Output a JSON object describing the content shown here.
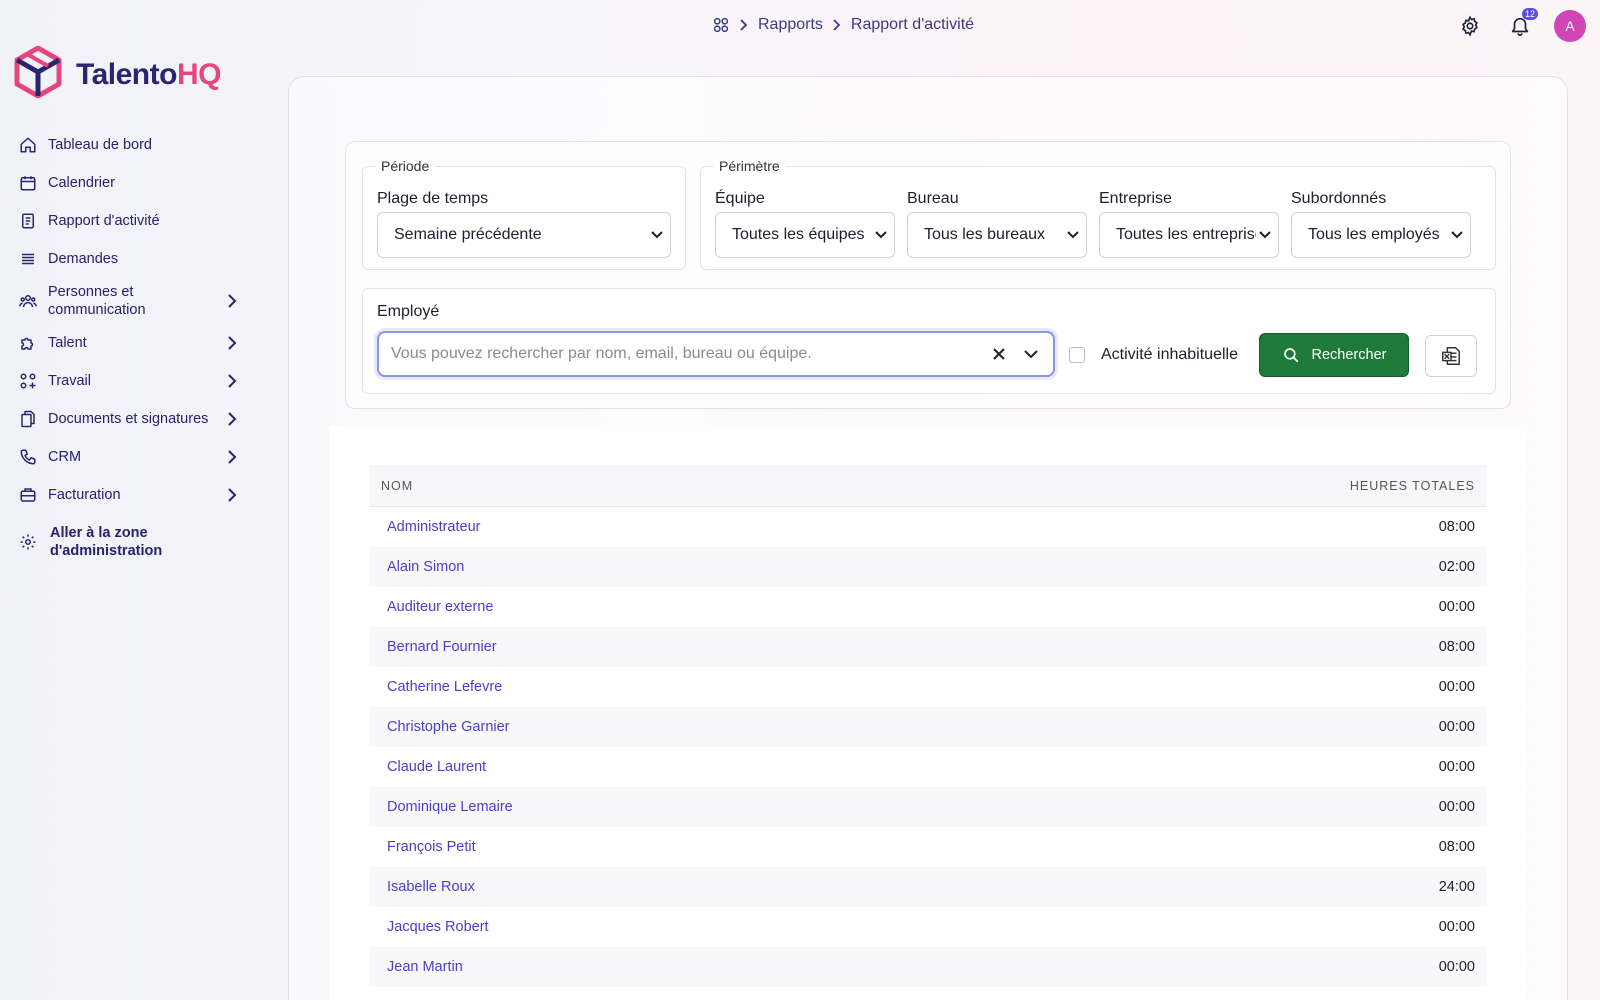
{
  "brand": {
    "part1": "Talento",
    "part2": "HQ"
  },
  "sidebar": {
    "items": [
      {
        "label": "Tableau de bord",
        "icon": "home-icon"
      },
      {
        "label": "Calendrier",
        "icon": "calendar-icon"
      },
      {
        "label": "Rapport d'activité",
        "icon": "report-icon"
      },
      {
        "label": "Demandes",
        "icon": "list-icon"
      },
      {
        "label": "Personnes et communication",
        "icon": "people-icon"
      },
      {
        "label": "Talent",
        "icon": "puzzle-icon"
      },
      {
        "label": "Travail",
        "icon": "grid-icon"
      },
      {
        "label": "Documents et signatures",
        "icon": "documents-icon"
      },
      {
        "label": "CRM",
        "icon": "phone-icon"
      },
      {
        "label": "Facturation",
        "icon": "briefcase-icon"
      }
    ],
    "admin_label": "Aller à la zone d'administration"
  },
  "breadcrumb": {
    "root_icon": "apps-grid-icon",
    "level1": "Rapports",
    "level2": "Rapport d'activité"
  },
  "header": {
    "notifications_count": "12",
    "avatar_initial": "A"
  },
  "filters": {
    "period_legend": "Période",
    "time_range_label": "Plage de temps",
    "time_range_value": "Semaine précédente",
    "scope_legend": "Périmètre",
    "team_label": "Équipe",
    "team_value": "Toutes les équipes",
    "office_label": "Bureau",
    "office_value": "Tous les bureaux",
    "company_label": "Entreprise",
    "company_value": "Toutes les entreprises",
    "subordinates_label": "Subordonnés",
    "subordinates_value": "Tous les employés",
    "employee_label": "Employé",
    "employee_placeholder": "Vous pouvez rechercher par nom, email, bureau ou équipe.",
    "unusual_activity_label": "Activité inhabituelle",
    "search_button": "Rechercher"
  },
  "table": {
    "col_name": "NOM",
    "col_hours": "HEURES TOTALES",
    "rows": [
      {
        "name": "Administrateur",
        "hours": "08:00"
      },
      {
        "name": "Alain Simon",
        "hours": "02:00"
      },
      {
        "name": "Auditeur externe",
        "hours": "00:00"
      },
      {
        "name": "Bernard Fournier",
        "hours": "08:00"
      },
      {
        "name": "Catherine Lefevre",
        "hours": "00:00"
      },
      {
        "name": "Christophe Garnier",
        "hours": "00:00"
      },
      {
        "name": "Claude Laurent",
        "hours": "00:00"
      },
      {
        "name": "Dominique Lemaire",
        "hours": "00:00"
      },
      {
        "name": "François Petit",
        "hours": "08:00"
      },
      {
        "name": "Isabelle Roux",
        "hours": "24:00"
      },
      {
        "name": "Jacques Robert",
        "hours": "00:00"
      },
      {
        "name": "Jean Martin",
        "hours": "00:00"
      }
    ]
  },
  "colors": {
    "brand_dark": "#2b2570",
    "brand_pink": "#e5467c",
    "link": "#4b3fc8",
    "search_button": "#1f7a3a",
    "avatar": "#cf46b4"
  }
}
